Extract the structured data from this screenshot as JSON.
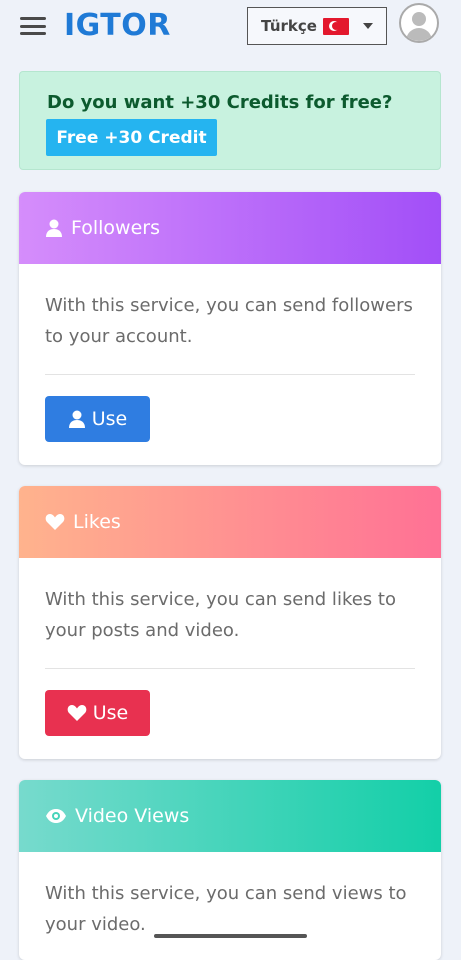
{
  "header": {
    "logo": "IGTOR",
    "language": "Türkçe"
  },
  "promo": {
    "text": "Do you want +30 Credits for free?",
    "button_label": "Free +30 Credit"
  },
  "cards": [
    {
      "title": "Followers",
      "description": "With this service, you can send followers to your account.",
      "button_label": "Use",
      "icon": "user-icon",
      "button_color": "#2f7de1"
    },
    {
      "title": "Likes",
      "description": "With this service, you can send likes to your posts and video.",
      "button_label": "Use",
      "icon": "heart-icon",
      "button_color": "#e83150"
    },
    {
      "title": "Video Views",
      "description": "With this service, you can send views to your video.",
      "icon": "eye-icon"
    }
  ],
  "colors": {
    "brand": "#1f7ad6",
    "promo_bg": "#c8f2df",
    "promo_button": "#25b4f0"
  }
}
